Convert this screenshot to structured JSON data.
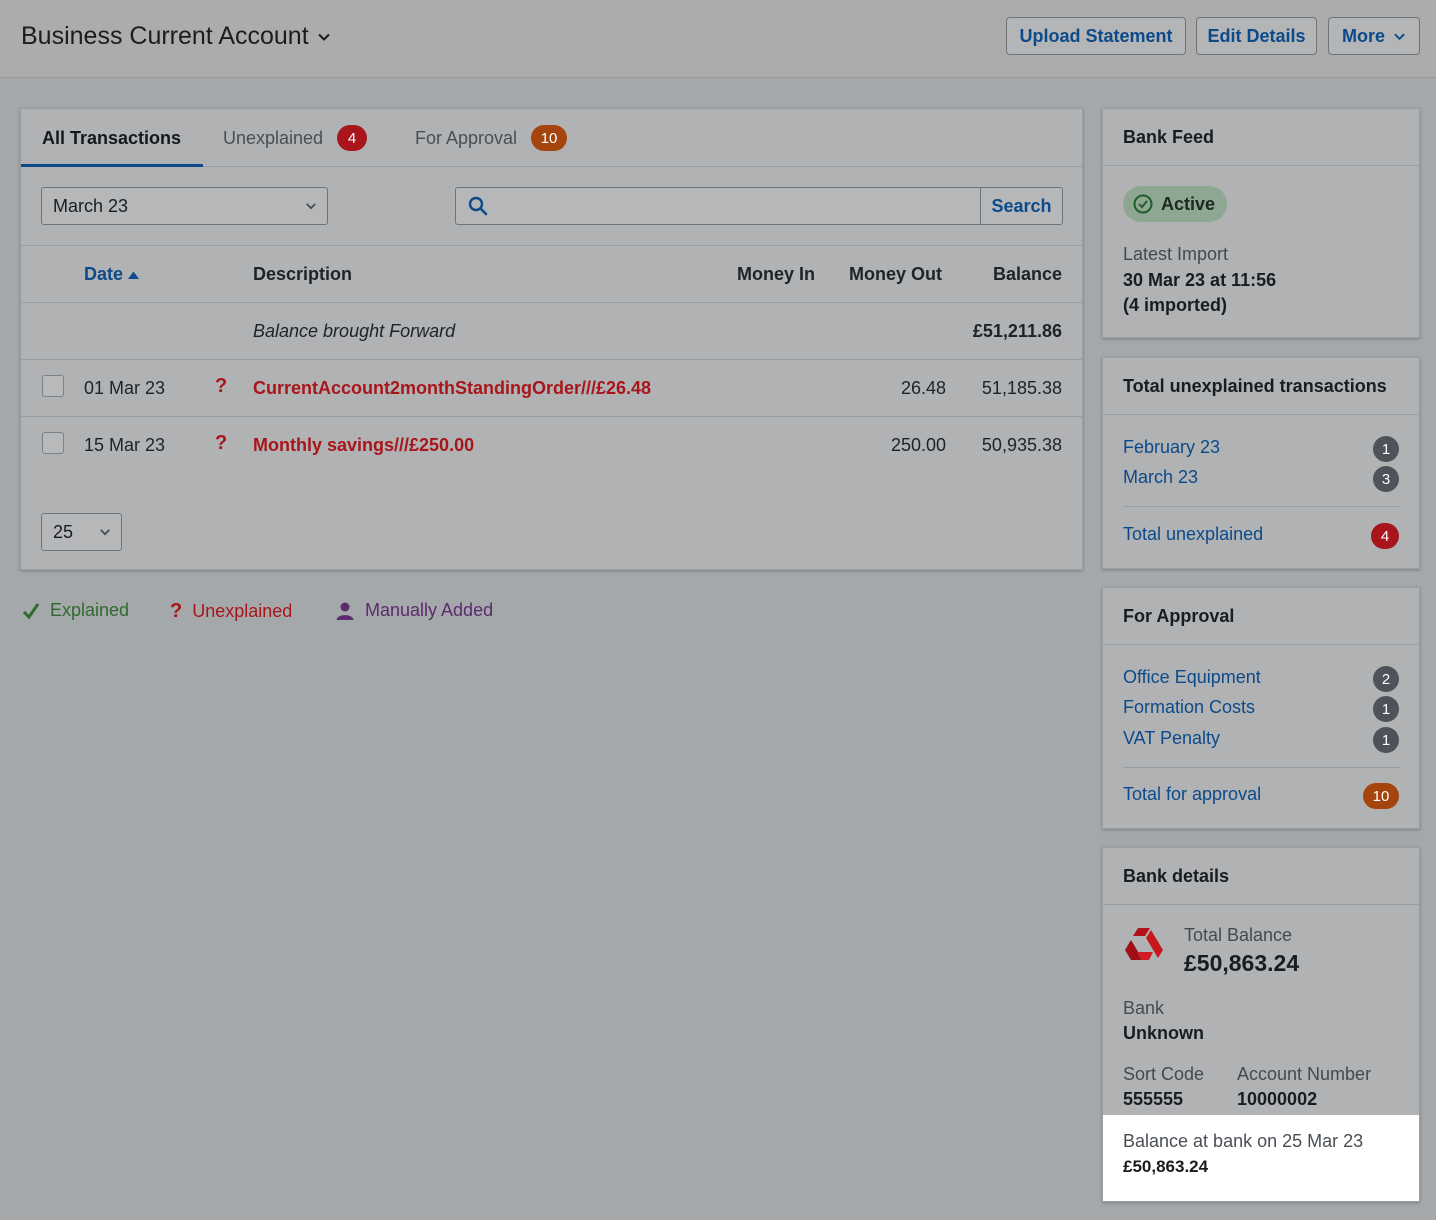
{
  "header": {
    "account_title": "Business Current Account",
    "upload_label": "Upload Statement",
    "edit_label": "Edit Details",
    "more_label": "More"
  },
  "tabs": {
    "all": "All Transactions",
    "unexplained": "Unexplained",
    "unexplained_count": "4",
    "approval": "For Approval",
    "approval_count": "10"
  },
  "filter": {
    "month": "March 23",
    "search_placeholder": "",
    "search_button": "Search",
    "page_size": "25"
  },
  "table": {
    "columns": {
      "date": "Date",
      "description": "Description",
      "money_in": "Money In",
      "money_out": "Money Out",
      "balance": "Balance"
    },
    "brought_forward": {
      "label": "Balance brought Forward",
      "balance": "£51,211.86"
    },
    "rows": [
      {
        "date": "01 Mar 23",
        "status": "?",
        "description": "CurrentAccount2monthStandingOrder///£26.48",
        "money_in": "",
        "money_out": "26.48",
        "balance": "51,185.38"
      },
      {
        "date": "15 Mar 23",
        "status": "?",
        "description": "Monthly savings///£250.00",
        "money_in": "",
        "money_out": "250.00",
        "balance": "50,935.38"
      }
    ]
  },
  "legend": {
    "explained": "Explained",
    "unexplained": "Unexplained",
    "manual": "Manually Added"
  },
  "bank_feed": {
    "title": "Bank Feed",
    "status": "Active",
    "latest_label": "Latest Import",
    "latest_value": "30 Mar 23 at 11:56",
    "latest_count": "(4 imported)"
  },
  "unexplained_panel": {
    "title": "Total unexplained transactions",
    "items": [
      {
        "label": "February 23",
        "count": "1"
      },
      {
        "label": "March 23",
        "count": "3"
      }
    ],
    "total_label": "Total unexplained",
    "total_count": "4"
  },
  "approval_panel": {
    "title": "For Approval",
    "items": [
      {
        "label": "Office Equipment",
        "count": "2"
      },
      {
        "label": "Formation Costs",
        "count": "1"
      },
      {
        "label": "VAT Penalty",
        "count": "1"
      }
    ],
    "total_label": "Total for approval",
    "total_count": "10"
  },
  "bank_details": {
    "title": "Bank details",
    "total_balance_label": "Total Balance",
    "total_balance": "£50,863.24",
    "bank_label": "Bank",
    "bank_value": "Unknown",
    "sort_code_label": "Sort Code",
    "sort_code": "555555",
    "account_number_label": "Account Number",
    "account_number": "10000002",
    "balance_at_bank_label": "Balance at bank on 25 Mar 23",
    "balance_at_bank": "£50,863.24"
  },
  "colors": {
    "link": "#0c4a8a",
    "unexplained": "#a8161c",
    "explained": "#2e6b2c",
    "manual": "#5e2a6e",
    "approval_badge": "#a5440d"
  },
  "icons": {
    "dropdown": "chevron-down-icon",
    "search": "search-icon",
    "sort": "sort-asc-icon",
    "status": "question-icon",
    "check": "check-icon",
    "user": "user-icon",
    "active": "check-circle-icon",
    "bank_logo": "bank-logo-icon"
  }
}
